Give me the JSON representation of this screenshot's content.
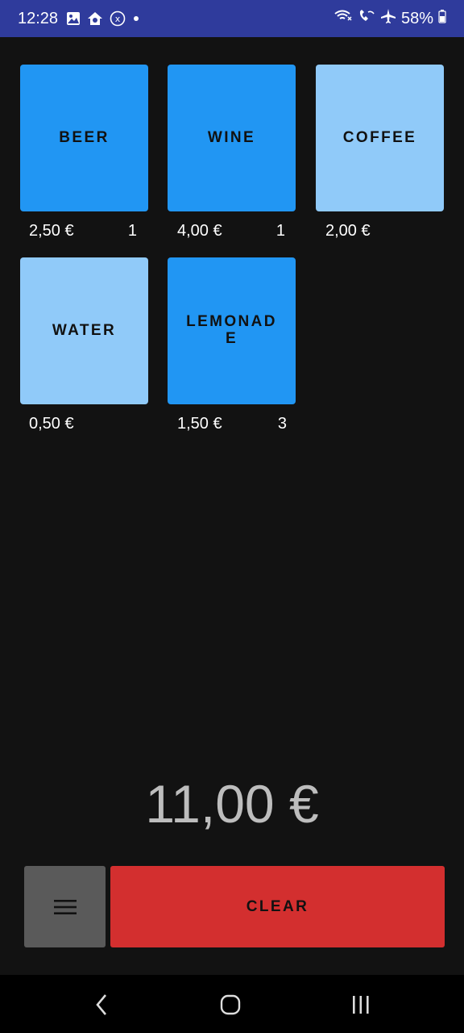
{
  "status_bar": {
    "time": "12:28",
    "battery": "58%",
    "icons": [
      "gallery-icon",
      "home-shield-icon",
      "x-circle-icon",
      "dot-icon",
      "wifi-calling-icon",
      "wifi-call-icon",
      "airplane-icon",
      "battery-icon"
    ]
  },
  "products": [
    {
      "name": "BEER",
      "price": "2,50 €",
      "count": "1",
      "selected": true
    },
    {
      "name": "WINE",
      "price": "4,00 €",
      "count": "1",
      "selected": true
    },
    {
      "name": "COFFEE",
      "price": "2,00 €",
      "count": "",
      "selected": false
    },
    {
      "name": "WATER",
      "price": "0,50 €",
      "count": "",
      "selected": false
    },
    {
      "name": "LEMONADE",
      "price": "1,50 €",
      "count": "3",
      "selected": true
    }
  ],
  "total": "11,00 €",
  "buttons": {
    "menu_icon": "hamburger-menu-icon",
    "clear_label": "CLEAR"
  },
  "colors": {
    "status_bar": "#2f3b9c",
    "tile_selected": "#2196f3",
    "tile_unselected": "#90caf9",
    "clear": "#d32f2f",
    "menu": "#5a5a5a",
    "background": "#121212"
  }
}
